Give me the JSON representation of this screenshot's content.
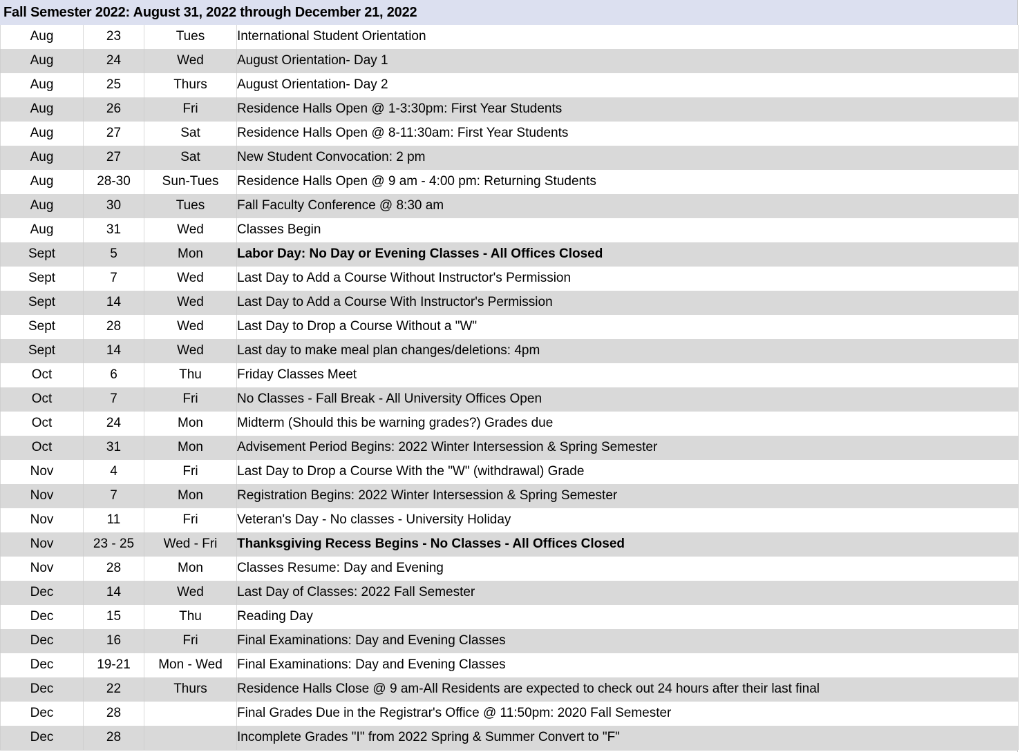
{
  "header": {
    "title": "Fall Semester 2022:  August 31, 2022 through December 21, 2022",
    "background_color": "#dce0f0"
  },
  "table": {
    "columns": [
      "Month",
      "Date",
      "Day",
      "Description"
    ],
    "row_shading": {
      "odd_color": "#ffffff",
      "even_color": "#d9d9d9"
    },
    "rows": [
      {
        "month": "Aug",
        "date": "23",
        "day": "Tues",
        "desc": "International Student Orientation",
        "bold": false
      },
      {
        "month": "Aug",
        "date": "24",
        "day": "Wed",
        "desc": "August Orientation- Day 1",
        "bold": false
      },
      {
        "month": "Aug",
        "date": "25",
        "day": "Thurs",
        "desc": "August Orientation- Day 2",
        "bold": false
      },
      {
        "month": "Aug",
        "date": "26",
        "day": "Fri",
        "desc": "Residence Halls Open  @ 1-3:30pm:  First Year Students",
        "bold": false
      },
      {
        "month": "Aug",
        "date": "27",
        "day": "Sat",
        "desc": "Residence Halls Open  @ 8-11:30am:  First Year Students",
        "bold": false
      },
      {
        "month": "Aug",
        "date": "27",
        "day": "Sat",
        "desc": "New Student  Convocation: 2 pm",
        "bold": false
      },
      {
        "month": "Aug",
        "date": "28-30",
        "day": "Sun-Tues",
        "desc": "Residence Halls Open @ 9 am - 4:00 pm:  Returning Students",
        "bold": false
      },
      {
        "month": "Aug",
        "date": "30",
        "day": "Tues",
        "desc": "Fall Faculty Conference @ 8:30 am",
        "bold": false
      },
      {
        "month": "Aug",
        "date": "31",
        "day": "Wed",
        "desc": "Classes Begin",
        "bold": false
      },
      {
        "month": "Sept",
        "date": "5",
        "day": "Mon",
        "desc": "Labor Day:  No Day or Evening Classes - All Offices Closed",
        "bold": true
      },
      {
        "month": "Sept",
        "date": "7",
        "day": "Wed",
        "desc": "Last Day to Add a Course Without Instructor's Permission",
        "bold": false
      },
      {
        "month": "Sept",
        "date": "14",
        "day": "Wed",
        "desc": "Last Day to Add a Course With Instructor's Permission",
        "bold": false
      },
      {
        "month": "Sept",
        "date": "28",
        "day": "Wed",
        "desc": "Last Day to Drop a Course Without a \"W\"",
        "bold": false
      },
      {
        "month": "Sept",
        "date": "14",
        "day": "Wed",
        "desc": "Last day to make meal plan changes/deletions:  4pm",
        "bold": false
      },
      {
        "month": "Oct",
        "date": "6",
        "day": "Thu",
        "desc": "Friday Classes Meet",
        "bold": false
      },
      {
        "month": "Oct",
        "date": "7",
        "day": "Fri",
        "desc": "No Classes - Fall Break - All University Offices Open",
        "bold": false
      },
      {
        "month": "Oct",
        "date": "24",
        "day": "Mon",
        "desc": "Midterm (Should this be warning grades?) Grades due",
        "bold": false
      },
      {
        "month": "Oct",
        "date": "31",
        "day": "Mon",
        "desc": "Advisement Period Begins:  2022 Winter Intersession & Spring Semester",
        "bold": false
      },
      {
        "month": "Nov",
        "date": "4",
        "day": "Fri",
        "desc": "Last Day to Drop a Course With the \"W\" (withdrawal) Grade",
        "bold": false
      },
      {
        "month": "Nov",
        "date": "7",
        "day": "Mon",
        "desc": "Registration Begins:  2022 Winter Intersession & Spring Semester",
        "bold": false
      },
      {
        "month": "Nov",
        "date": "11",
        "day": "Fri",
        "desc": "Veteran's Day - No classes - University Holiday",
        "bold": false
      },
      {
        "month": "Nov",
        "date": "23 - 25",
        "day": "Wed - Fri",
        "desc": "Thanksgiving Recess Begins - No Classes - All Offices Closed",
        "bold": true
      },
      {
        "month": "Nov",
        "date": "28",
        "day": "Mon",
        "desc": "Classes Resume:  Day and Evening",
        "bold": false
      },
      {
        "month": "Dec",
        "date": "14",
        "day": "Wed",
        "desc": "Last Day of Classes:  2022 Fall Semester",
        "bold": false
      },
      {
        "month": "Dec",
        "date": "15",
        "day": "Thu",
        "desc": "Reading Day",
        "bold": false
      },
      {
        "month": "Dec",
        "date": "16",
        "day": "Fri",
        "desc": "Final Examinations: Day and Evening Classes",
        "bold": false
      },
      {
        "month": "Dec",
        "date": "19-21",
        "day": "Mon - Wed",
        "desc": "Final Examinations:  Day and Evening Classes",
        "bold": false
      },
      {
        "month": "Dec",
        "date": "22",
        "day": "Thurs",
        "desc": "Residence Halls Close @ 9 am-All Residents are expected to check out 24 hours after their last final",
        "bold": false
      },
      {
        "month": "Dec",
        "date": "28",
        "day": "",
        "desc": "Final Grades Due in the Registrar's Office @ 11:50pm: 2020  Fall Semester",
        "bold": false
      },
      {
        "month": "Dec",
        "date": "28",
        "day": "",
        "desc": "Incomplete Grades \"I\" from 2022 Spring & Summer  Convert to \"F\"",
        "bold": false
      }
    ]
  }
}
